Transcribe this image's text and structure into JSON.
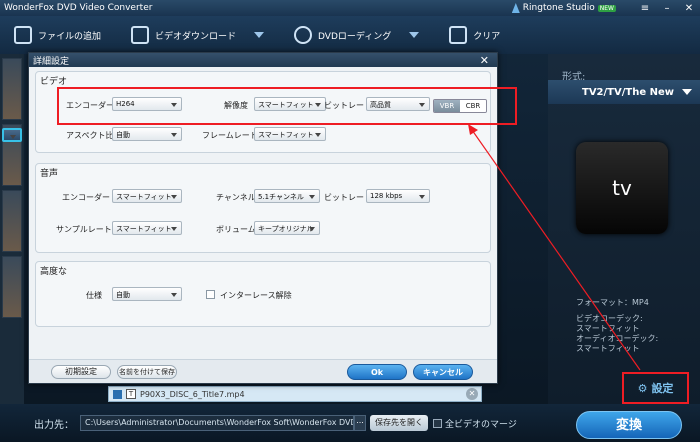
{
  "window": {
    "title": "WonderFox DVD Video Converter",
    "ringtone_label": "Ringtone Studio",
    "ringtone_badge": "NEW"
  },
  "toolbar": {
    "add_file": "ファイルの追加",
    "video_download": "ビデオダウンロード",
    "dvd_loading": "DVDローディング",
    "clear": "クリア"
  },
  "dialog": {
    "title": "詳細設定",
    "video": {
      "section": "ビデオ",
      "encoder_label": "エンコーダー",
      "encoder_value": "H264",
      "resolution_label": "解像度",
      "resolution_value": "スマートフィット",
      "bitrate_label": "ビットレート",
      "bitrate_value": "高品質",
      "vbr": "VBR",
      "cbr": "CBR",
      "aspect_label": "アスペクト比",
      "aspect_value": "自動",
      "framerate_label": "フレームレート",
      "framerate_value": "スマートフィット"
    },
    "audio": {
      "section": "音声",
      "encoder_label": "エンコーダー",
      "encoder_value": "スマートフィット",
      "channel_label": "チャンネル",
      "channel_value": "5.1チャンネル",
      "bitrate_label": "ビットレート",
      "bitrate_value": "128 kbps",
      "samplerate_label": "サンプルレート",
      "samplerate_value": "スマートフィット",
      "volume_label": "ボリューム",
      "volume_value": "キープオリジナル"
    },
    "advanced": {
      "section": "高度な",
      "spec_label": "仕様",
      "spec_value": "自動",
      "deinterlace_label": "インターレース解除"
    },
    "footer": {
      "reset": "初期設定",
      "save_as": "名前を付けて保存",
      "ok": "Ok",
      "cancel": "キャンセル"
    }
  },
  "right_panel": {
    "format_label": "形式:",
    "format_value": "TV2/TV/The New",
    "device_label": "tv",
    "format_info": "フォーマット：MP4",
    "video_codec_label": "ビデオコーデック:",
    "video_codec_value": "スマートフィット",
    "audio_codec_label": "オーディオコーデック:",
    "audio_codec_value": "スマートフィット",
    "settings_label": "設定"
  },
  "file": {
    "name": "P90X3_DISC_6_Title7.mp4"
  },
  "bottom": {
    "output_label": "出力先：",
    "output_path": "C:\\Users\\Administrator\\Documents\\WonderFox Soft\\WonderFox DVD Vi...",
    "dots": "...",
    "open_folder": "保存先を開く",
    "merge_all": "全ビデオのマージ",
    "convert": "変換"
  }
}
